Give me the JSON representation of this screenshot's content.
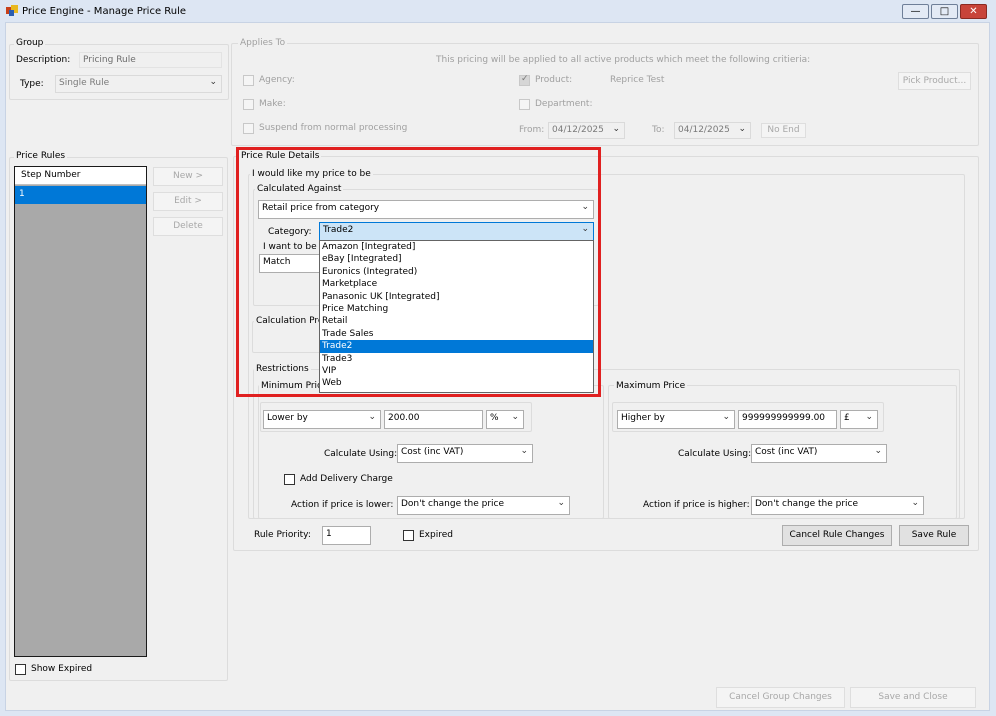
{
  "window": {
    "title": "Price Engine - Manage Price Rule"
  },
  "group": {
    "title": "Group",
    "description_label": "Description:",
    "description_value": "Pricing Rule",
    "type_label": "Type:",
    "type_value": "Single Rule"
  },
  "applies_to": {
    "title": "Applies To",
    "note": "This pricing will be applied to all active products which meet the following critieria:",
    "agency_label": "Agency:",
    "make_label": "Make:",
    "suspend_label": "Suspend from normal processing",
    "product_label": "Product:",
    "product_value": "Reprice Test",
    "department_label": "Department:",
    "pick_product_button": "Pick Product...",
    "from_label": "From:",
    "from_value": "04/12/2025",
    "to_label": "To:",
    "to_value": "04/12/2025",
    "no_end_button": "No End"
  },
  "price_rules": {
    "title": "Price Rules",
    "column_header": "Step Number",
    "rows": [
      "1"
    ],
    "new_button": "New >",
    "edit_button": "Edit >",
    "delete_button": "Delete",
    "show_expired_label": "Show Expired"
  },
  "details": {
    "title": "Price Rule Details",
    "sub_title": "I would like my price to be",
    "calculated_against_title": "Calculated Against",
    "calculated_against_value": "Retail price from category",
    "category_label": "Category:",
    "category_value": "Trade2",
    "category_options": [
      "Amazon [Integrated]",
      "eBay [Integrated]",
      "Euronics (Integrated)",
      "Marketplace",
      "Panasonic UK [Integrated]",
      "Price Matching",
      "Retail",
      "Trade Sales",
      "Trade2",
      "Trade3",
      "VIP",
      "Web"
    ],
    "selected_option_index": 8,
    "i_want_to_be_label": "I want to be",
    "match_value": "Match",
    "calculation_prefix": "Calculation Pre",
    "restrictions_title": "Restrictions",
    "minimum_price_title": "Minimum Price",
    "maximum_price_title": "Maximum Price",
    "min_mode": "Lower by",
    "min_amount": "200.00",
    "min_unit": "%",
    "max_mode": "Higher by",
    "max_amount": "999999999999.00",
    "max_unit": "£",
    "calculate_using_label": "Calculate Using:",
    "min_calculate_using": "Cost (inc VAT)",
    "max_calculate_using": "Cost (inc VAT)",
    "add_delivery_charge_label": "Add Delivery Charge",
    "action_lower_label": "Action if price is lower:",
    "action_higher_label": "Action if price is higher:",
    "min_action": "Don't change the price",
    "max_action": "Don't change the price",
    "rule_priority_label": "Rule Priority:",
    "rule_priority_value": "1",
    "expired_label": "Expired",
    "cancel_rule_button": "Cancel Rule Changes",
    "save_rule_button": "Save Rule"
  },
  "footer": {
    "cancel_group_button": "Cancel Group Changes",
    "save_close_button": "Save and Close"
  },
  "colors": {
    "highlight": "#e02020",
    "selection": "#0078d7",
    "list_bg": "#a9a9a9"
  }
}
